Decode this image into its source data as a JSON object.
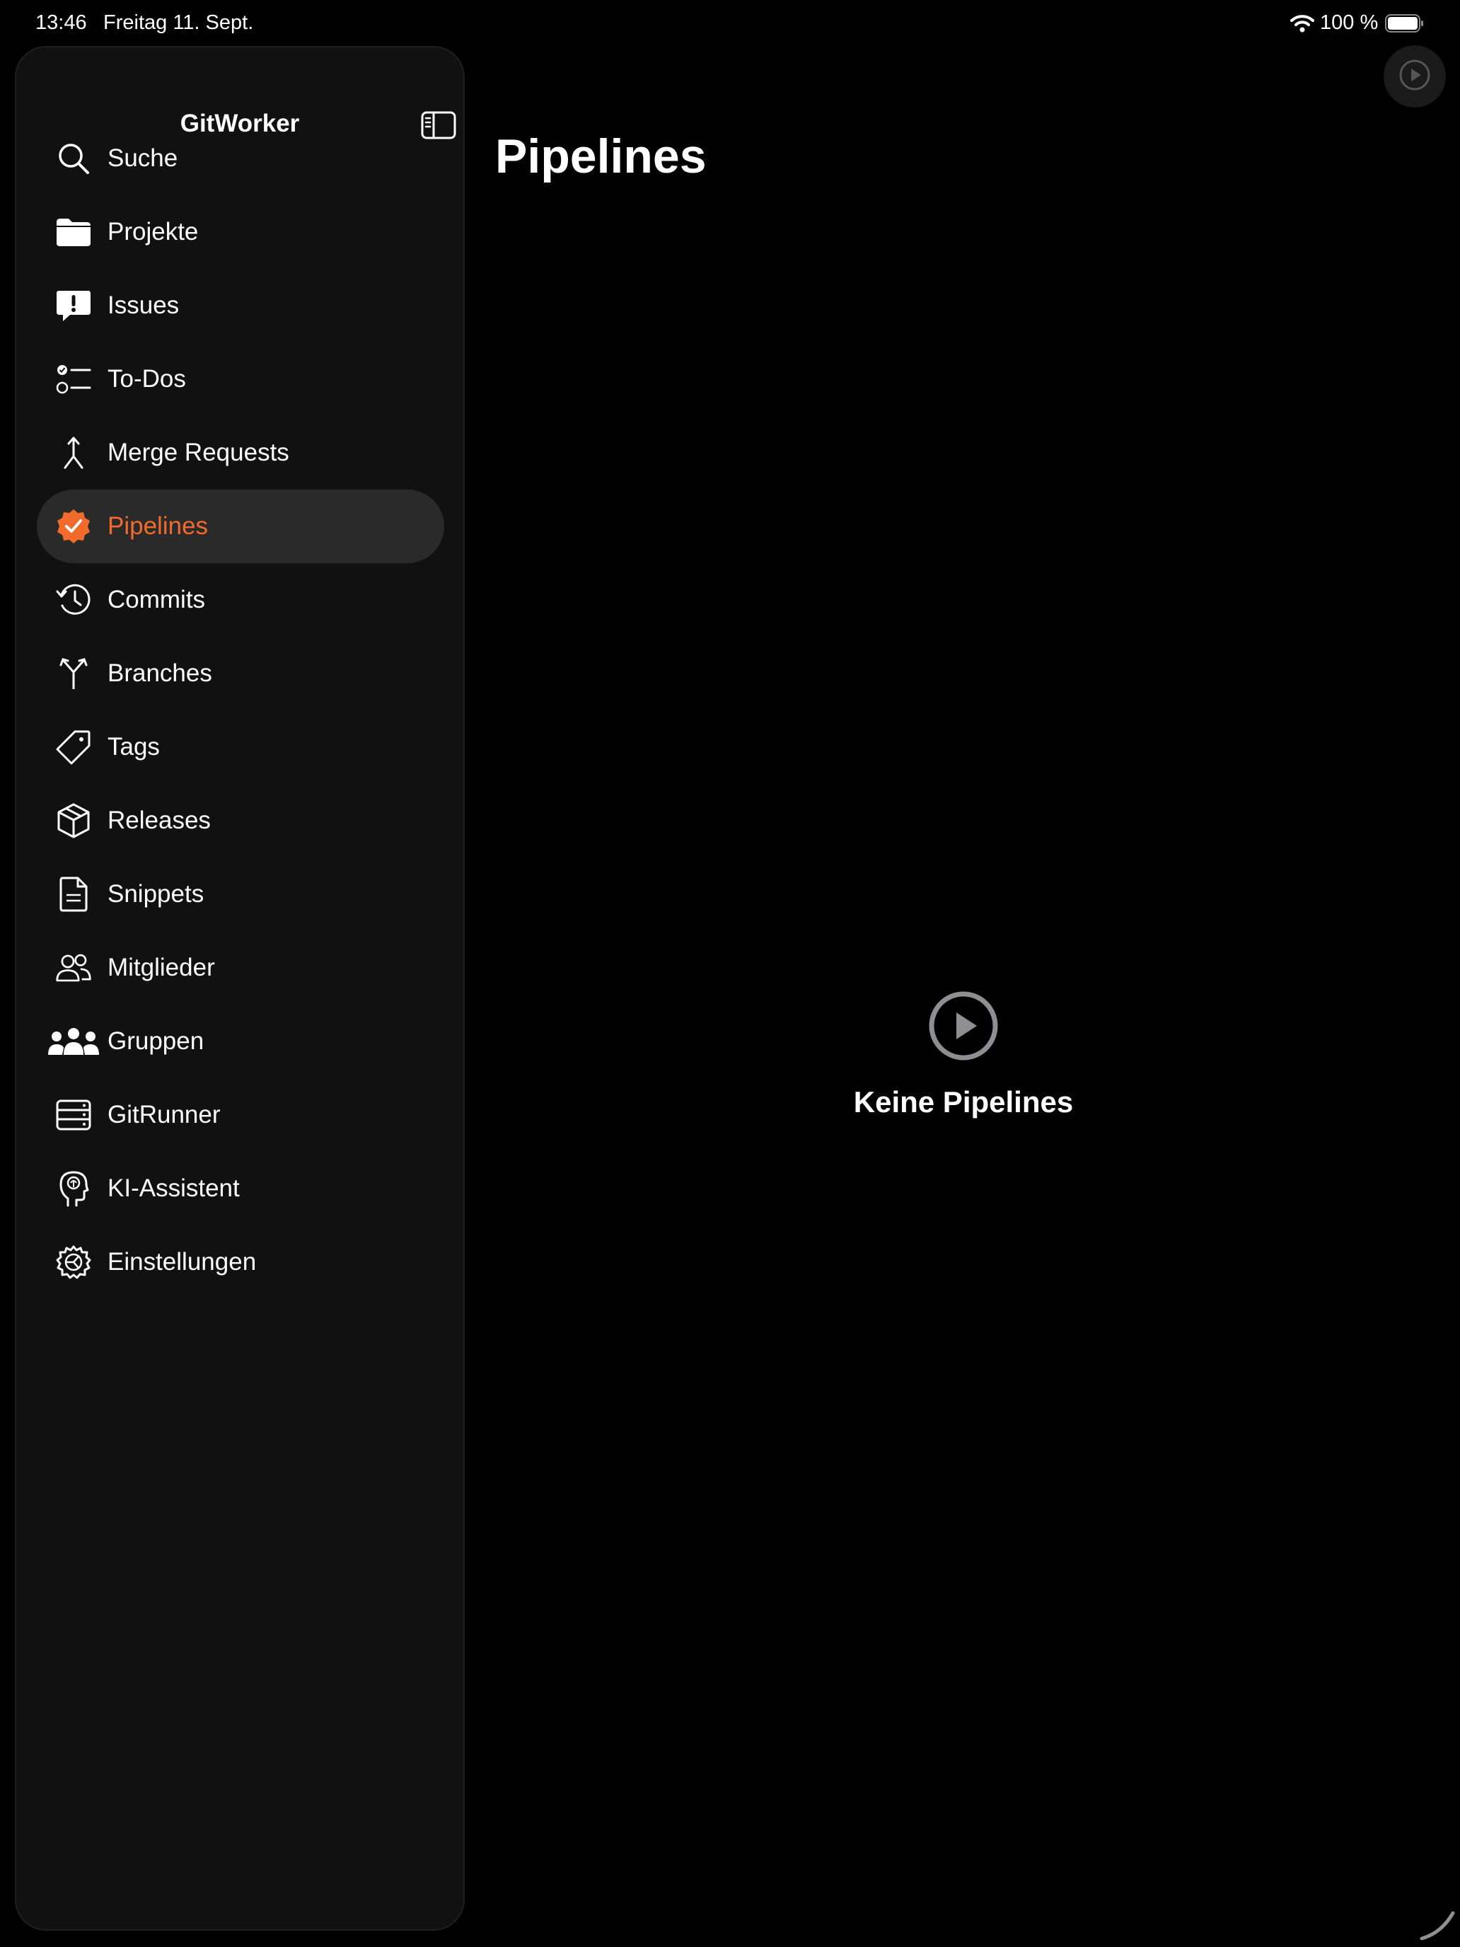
{
  "status_bar": {
    "time": "13:46",
    "date": "Freitag 11. Sept.",
    "battery": "100 %"
  },
  "sidebar": {
    "title": "GitWorker",
    "items": [
      {
        "label": "Suche",
        "icon": "search-icon"
      },
      {
        "label": "Projekte",
        "icon": "folder-icon"
      },
      {
        "label": "Issues",
        "icon": "exclamation-bubble-icon"
      },
      {
        "label": "To-Dos",
        "icon": "checklist-icon"
      },
      {
        "label": "Merge Requests",
        "icon": "merge-icon"
      },
      {
        "label": "Pipelines",
        "icon": "checkmark-seal-icon",
        "active": true
      },
      {
        "label": "Commits",
        "icon": "history-clock-icon"
      },
      {
        "label": "Branches",
        "icon": "branch-icon"
      },
      {
        "label": "Tags",
        "icon": "tag-icon"
      },
      {
        "label": "Releases",
        "icon": "package-box-icon"
      },
      {
        "label": "Snippets",
        "icon": "document-icon"
      },
      {
        "label": "Mitglieder",
        "icon": "people-icon"
      },
      {
        "label": "Gruppen",
        "icon": "group-icon"
      },
      {
        "label": "GitRunner",
        "icon": "server-rack-icon"
      },
      {
        "label": "KI-Assistent",
        "icon": "brain-head-icon"
      },
      {
        "label": "Einstellungen",
        "icon": "gear-play-icon"
      }
    ]
  },
  "main": {
    "title": "Pipelines",
    "empty_state": {
      "icon": "play-circle-icon",
      "text": "Keine Pipelines"
    }
  },
  "colors": {
    "background": "#000000",
    "sidebar": "#111111",
    "active_bg": "#2a2a2a",
    "accent": "#f26b2a"
  }
}
